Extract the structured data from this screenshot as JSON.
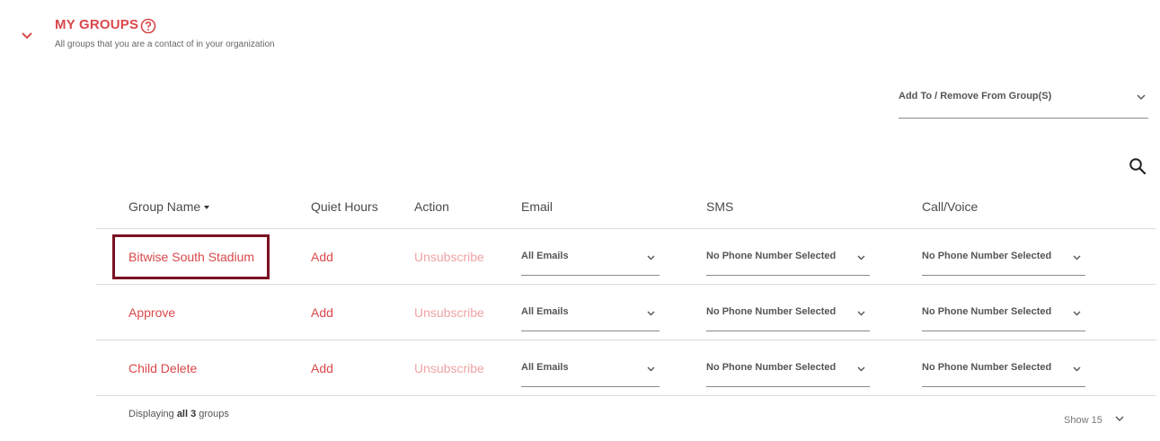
{
  "section": {
    "title": "MY GROUPS",
    "subtitle": "All groups that you are a contact of in your organization"
  },
  "group_action": {
    "label": "Add To / Remove From Group(S)"
  },
  "table": {
    "headers": {
      "group_name": "Group Name",
      "quiet_hours": "Quiet Hours",
      "action": "Action",
      "email": "Email",
      "sms": "SMS",
      "call": "Call/Voice"
    },
    "rows": [
      {
        "name": "Bitwise South Stadium",
        "quiet_hours": "Add",
        "action": "Unsubscribe",
        "email": "All Emails",
        "sms": "No Phone Number Selected",
        "call": "No Phone Number Selected"
      },
      {
        "name": "Approve",
        "quiet_hours": "Add",
        "action": "Unsubscribe",
        "email": "All Emails",
        "sms": "No Phone Number Selected",
        "call": "No Phone Number Selected"
      },
      {
        "name": "Child Delete",
        "quiet_hours": "Add",
        "action": "Unsubscribe",
        "email": "All Emails",
        "sms": "No Phone Number Selected",
        "call": "No Phone Number Selected"
      }
    ]
  },
  "footer": {
    "prefix": "Displaying",
    "count": "all 3",
    "suffix": "groups",
    "show_label": "Show 15"
  },
  "colors": {
    "accent": "#d9484b",
    "selected_outline": "#7a1023",
    "faded_link": "#f0a3a3"
  },
  "icons": {
    "collapse": "chevron-down-icon",
    "help": "question-circle-icon",
    "search": "search-icon"
  }
}
